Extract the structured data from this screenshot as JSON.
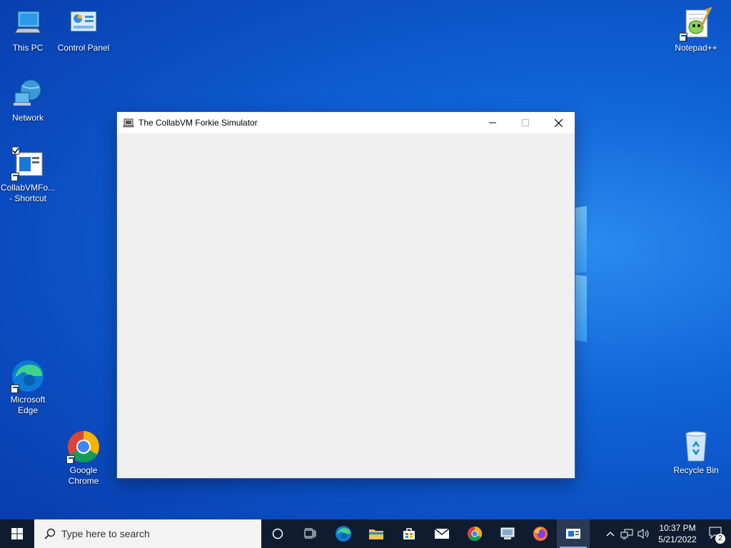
{
  "desktop": {
    "icons": [
      {
        "label": "This PC"
      },
      {
        "label": "Control Panel"
      },
      {
        "label": "Network"
      },
      {
        "label": "CollabVMFo... - Shortcut"
      },
      {
        "label": "Microsoft Edge"
      },
      {
        "label": "Google Chrome"
      },
      {
        "label": "Notepad++"
      },
      {
        "label": "Recycle Bin"
      }
    ]
  },
  "window": {
    "title": "The CollabVM Forkie Simulator",
    "content_color": "#f0f0f0"
  },
  "taskbar": {
    "search_placeholder": "Type here to search",
    "clock_time": "10:37 PM",
    "clock_date": "5/21/2022",
    "notification_count": "2",
    "pinned": [
      "cortana-icon",
      "task-view-icon",
      "edge-icon",
      "file-explorer-icon",
      "store-icon",
      "mail-icon",
      "chrome-icon",
      "remote-desktop-icon",
      "firefox-icon",
      "forkie-app-icon"
    ]
  },
  "colors": {
    "desktop_blue": "#0a4cc0",
    "taskbar": "#0f1c30"
  }
}
